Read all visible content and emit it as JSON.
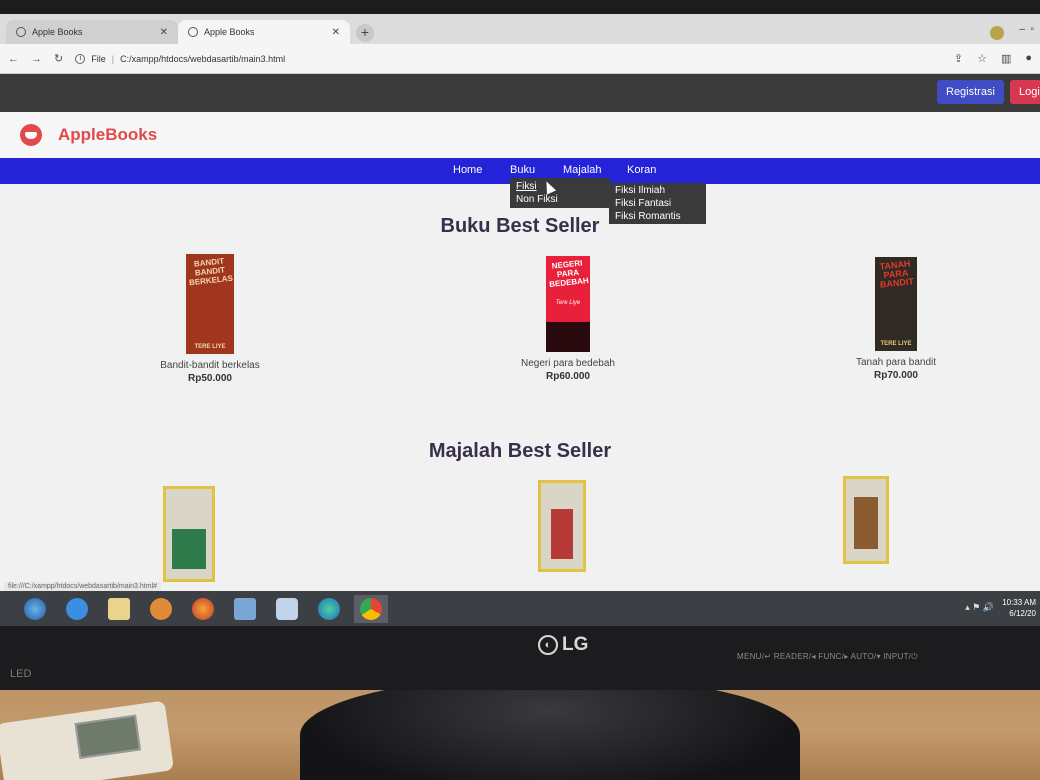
{
  "browser": {
    "tabs": [
      {
        "label": "Apple Books",
        "active": false
      },
      {
        "label": "Apple Books",
        "active": true
      }
    ],
    "address": {
      "scheme_label": "File",
      "path": "C:/xampp/htdocs/webdasartib/main3.html"
    },
    "status_url": "file:///C:/xampp/htdocs/webdasartib/main3.html#"
  },
  "header": {
    "register_label": "Registrasi",
    "login_label": "Logi",
    "brand": "AppleBooks",
    "brand_color": "#e04a4a"
  },
  "nav": {
    "items": [
      "Home",
      "Buku",
      "Majalah",
      "Koran"
    ],
    "bar_color": "#2423d8",
    "buku_dropdown": [
      "Fiksi",
      "Non Fiksi"
    ],
    "fiksi_submenu": [
      "Fiksi Ilmiah",
      "Fiksi Fantasi",
      "Fiksi Romantis"
    ]
  },
  "books_section": {
    "title": "Buku Best Seller",
    "items": [
      {
        "title": "Bandit-bandit berkelas",
        "price": "Rp50.000",
        "cover_text": "BANDIT BANDIT BERKELAS",
        "author": "TERE LIYE",
        "cover_color": "#a1361e"
      },
      {
        "title": "Negeri para bedebah",
        "price": "Rp60.000",
        "cover_text": "NEGERI PARA BEDEBAH",
        "author": "Tere Liye",
        "cover_color": "#e8203a"
      },
      {
        "title": "Tanah para bandit",
        "price": "Rp70.000",
        "cover_text": "TANAH PARA BANDIT",
        "author": "TERE LIYE",
        "cover_color": "#2f2a24"
      }
    ]
  },
  "magazines_section": {
    "title": "Majalah Best Seller"
  },
  "taskbar": {
    "time": "10:33 AM",
    "date": "6/12/20"
  },
  "monitor": {
    "brand": "LG",
    "buttons": "MENU/↵  READER/◂  FUNC/▸  AUTO/▾  INPUT/⏻",
    "led": "LED"
  }
}
